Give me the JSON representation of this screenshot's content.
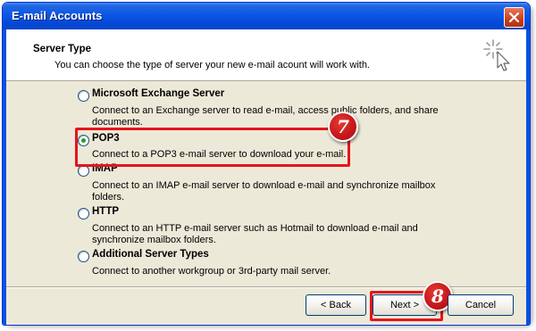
{
  "window": {
    "title": "E-mail Accounts"
  },
  "header": {
    "title": "Server Type",
    "subtitle": "You can choose the type of server your new e-mail acount will work with."
  },
  "options": [
    {
      "label": "Microsoft Exchange Server",
      "description": "Connect to an Exchange server to read e-mail, access public folders, and share documents.",
      "selected": false
    },
    {
      "label": "POP3",
      "description": "Connect to a POP3 e-mail server to download your e-mail.",
      "selected": true
    },
    {
      "label": "IMAP",
      "description": "Connect to an IMAP e-mail server to download e-mail and synchronize mailbox folders.",
      "selected": false
    },
    {
      "label": "HTTP",
      "description": "Connect to an HTTP e-mail server such as Hotmail to download e-mail and synchronize mailbox folders.",
      "selected": false
    },
    {
      "label": "Additional Server Types",
      "description": "Connect to another workgroup or 3rd-party mail server.",
      "selected": false
    }
  ],
  "callouts": {
    "step7": "7",
    "step8": "8"
  },
  "buttons": {
    "back": "< Back",
    "next": "Next >",
    "cancel": "Cancel"
  },
  "icons": {
    "close": "close-icon",
    "wizard": "wizard-sparkle-cursor-icon"
  },
  "colors": {
    "titlebar": "#0a58e6",
    "highlight": "#e5141e",
    "dialog_bg": "#ece9d8"
  }
}
